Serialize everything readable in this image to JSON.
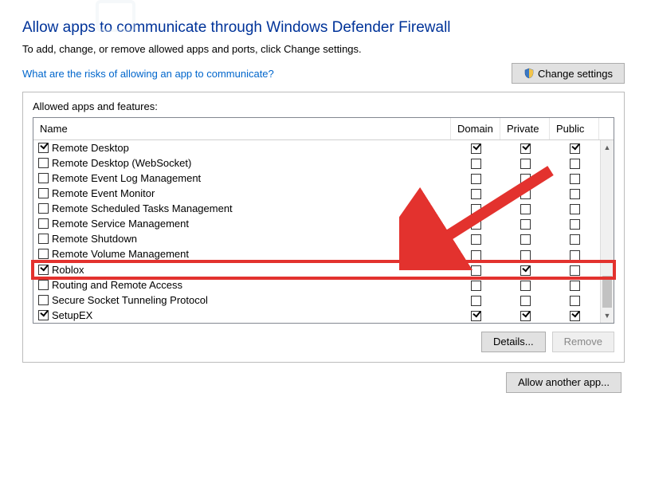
{
  "header": {
    "title": "Allow apps to communicate through Windows Defender Firewall",
    "subtitle": "To add, change, or remove allowed apps and ports, click Change settings.",
    "risks_link": "What are the risks of allowing an app to communicate?",
    "change_settings_label": "Change settings"
  },
  "panel": {
    "label": "Allowed apps and features:",
    "columns": {
      "name": "Name",
      "domain": "Domain",
      "private": "Private",
      "public": "Public"
    },
    "rows": [
      {
        "name": "Remote Desktop",
        "enabled": true,
        "domain": true,
        "private": true,
        "public": true
      },
      {
        "name": "Remote Desktop (WebSocket)",
        "enabled": false,
        "domain": false,
        "private": false,
        "public": false
      },
      {
        "name": "Remote Event Log Management",
        "enabled": false,
        "domain": false,
        "private": false,
        "public": false
      },
      {
        "name": "Remote Event Monitor",
        "enabled": false,
        "domain": false,
        "private": false,
        "public": false
      },
      {
        "name": "Remote Scheduled Tasks Management",
        "enabled": false,
        "domain": false,
        "private": false,
        "public": false
      },
      {
        "name": "Remote Service Management",
        "enabled": false,
        "domain": false,
        "private": false,
        "public": false
      },
      {
        "name": "Remote Shutdown",
        "enabled": false,
        "domain": false,
        "private": false,
        "public": false
      },
      {
        "name": "Remote Volume Management",
        "enabled": false,
        "domain": false,
        "private": false,
        "public": false
      },
      {
        "name": "Roblox",
        "enabled": true,
        "domain": false,
        "private": true,
        "public": false,
        "highlighted": true
      },
      {
        "name": "Routing and Remote Access",
        "enabled": false,
        "domain": false,
        "private": false,
        "public": false
      },
      {
        "name": "Secure Socket Tunneling Protocol",
        "enabled": false,
        "domain": false,
        "private": false,
        "public": false
      },
      {
        "name": "SetupEX",
        "enabled": true,
        "domain": true,
        "private": true,
        "public": true
      }
    ],
    "details_label": "Details...",
    "remove_label": "Remove"
  },
  "footer": {
    "allow_another_label": "Allow another app..."
  },
  "annotation": {
    "arrow_color": "#e3322e",
    "highlight_color": "#e3322e"
  }
}
